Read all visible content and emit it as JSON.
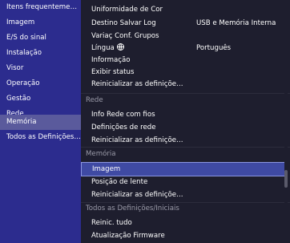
{
  "sidebar": {
    "items": [
      {
        "label": "Itens frequentemente ...",
        "selected": false
      },
      {
        "label": "Imagem",
        "selected": false
      },
      {
        "label": "E/S do sinal",
        "selected": false
      },
      {
        "label": "Instalação",
        "selected": false
      },
      {
        "label": "Visor",
        "selected": false
      },
      {
        "label": "Operação",
        "selected": false
      },
      {
        "label": "Gestão",
        "selected": false
      },
      {
        "label": "Rede",
        "selected": false
      },
      {
        "label": "Memória",
        "selected": true
      },
      {
        "label": "Todos as Definições/Inici...",
        "selected": false
      }
    ]
  },
  "main": {
    "top_rows": [
      {
        "label": "Uniformidade de Cor",
        "value": ""
      },
      {
        "label": "Destino Salvar Log",
        "value": "USB e Memória Interna"
      },
      {
        "label": "Variaç Conf. Grupos",
        "value": ""
      },
      {
        "label": "Língua",
        "value": "Português",
        "icon": "globe-icon"
      },
      {
        "label": "Informação",
        "value": ""
      },
      {
        "label": "Exibir status",
        "value": ""
      },
      {
        "label": "Reinicializar as definições de ...",
        "value": ""
      }
    ],
    "section_rede": "Rede",
    "rede_rows": [
      {
        "label": "Info Rede com fios"
      },
      {
        "label": "Definições de rede"
      },
      {
        "label": "Reinicializar as definições de ..."
      }
    ],
    "section_memoria": "Memória",
    "memoria_rows": [
      {
        "label": "Imagem",
        "selected": true
      },
      {
        "label": "Posição de lente"
      },
      {
        "label": "Reinicializar as definições da ..."
      }
    ],
    "section_todos": "Todos as Definições/Iniciais",
    "todos_rows": [
      {
        "label": "Reinic. tudo"
      },
      {
        "label": "Atualização Firmware"
      }
    ]
  },
  "colors": {
    "sidebar_bg": "#2c2c8e",
    "sidebar_selected": "#5a5a9c",
    "main_bg": "#1e1e2e",
    "row_selected": "#3f4aa3",
    "section_text": "#9a9aa8"
  }
}
